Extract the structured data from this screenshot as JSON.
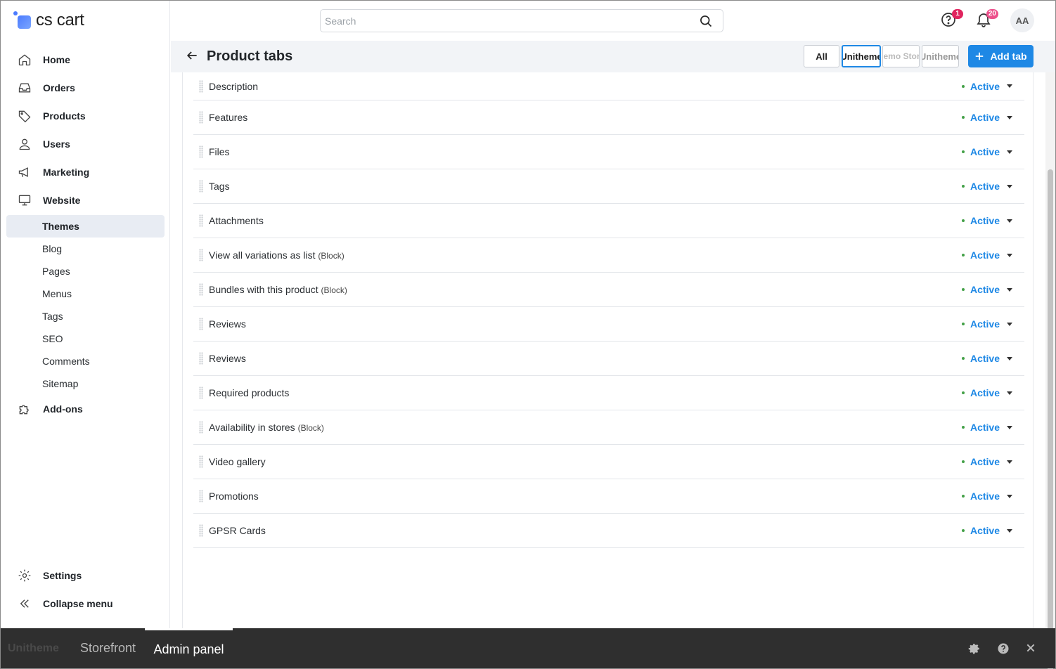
{
  "app": {
    "logo_text": "cs cart"
  },
  "sidebar": {
    "items": [
      {
        "label": "Home",
        "icon": "home-icon"
      },
      {
        "label": "Orders",
        "icon": "inbox-icon"
      },
      {
        "label": "Products",
        "icon": "tag-icon"
      },
      {
        "label": "Users",
        "icon": "user-icon"
      },
      {
        "label": "Marketing",
        "icon": "megaphone-icon"
      },
      {
        "label": "Website",
        "icon": "monitor-icon"
      }
    ],
    "website_sub": [
      {
        "label": "Themes",
        "active": true
      },
      {
        "label": "Blog"
      },
      {
        "label": "Pages"
      },
      {
        "label": "Menus"
      },
      {
        "label": "Tags"
      },
      {
        "label": "SEO"
      },
      {
        "label": "Comments"
      },
      {
        "label": "Sitemap"
      }
    ],
    "addons": {
      "label": "Add-ons",
      "icon": "puzzle-icon"
    },
    "settings": {
      "label": "Settings",
      "icon": "gear-icon"
    },
    "collapse": {
      "label": "Collapse menu",
      "icon": "chevrons-left-icon"
    }
  },
  "topbar": {
    "search_placeholder": "Search",
    "help_badge": "1",
    "notifications_badge": "20",
    "avatar_initials": "AA"
  },
  "page": {
    "title": "Product tabs",
    "storefront_filters": [
      {
        "label": "All",
        "selected": false
      },
      {
        "label": "Unitheme",
        "selected": true
      },
      {
        "label": "Demo Store",
        "selected": false
      },
      {
        "label": "Unitheme",
        "selected": false
      }
    ],
    "add_button": "Add tab"
  },
  "tabs": [
    {
      "name": "Description",
      "block": "",
      "status": "Active"
    },
    {
      "name": "Features",
      "block": "",
      "status": "Active"
    },
    {
      "name": "Files",
      "block": "",
      "status": "Active"
    },
    {
      "name": "Tags",
      "block": "",
      "status": "Active"
    },
    {
      "name": "Attachments",
      "block": "",
      "status": "Active"
    },
    {
      "name": "View all variations as list",
      "block": "(Block)",
      "status": "Active"
    },
    {
      "name": "Bundles with this product",
      "block": "(Block)",
      "status": "Active"
    },
    {
      "name": "Reviews",
      "block": "",
      "status": "Active"
    },
    {
      "name": "Reviews",
      "block": "",
      "status": "Active"
    },
    {
      "name": "Required products",
      "block": "",
      "status": "Active"
    },
    {
      "name": "Availability in stores",
      "block": "(Block)",
      "status": "Active"
    },
    {
      "name": "Video gallery",
      "block": "",
      "status": "Active"
    },
    {
      "name": "Promotions",
      "block": "",
      "status": "Active"
    },
    {
      "name": "GPSR Cards",
      "block": "",
      "status": "Active"
    }
  ],
  "bottombar": {
    "logo": "Unitheme",
    "storefront_label": "Storefront",
    "admin_label": "Admin panel"
  },
  "colors": {
    "accent": "#1e88e5",
    "active_dot": "#43a047",
    "badge": "#e0245e"
  }
}
